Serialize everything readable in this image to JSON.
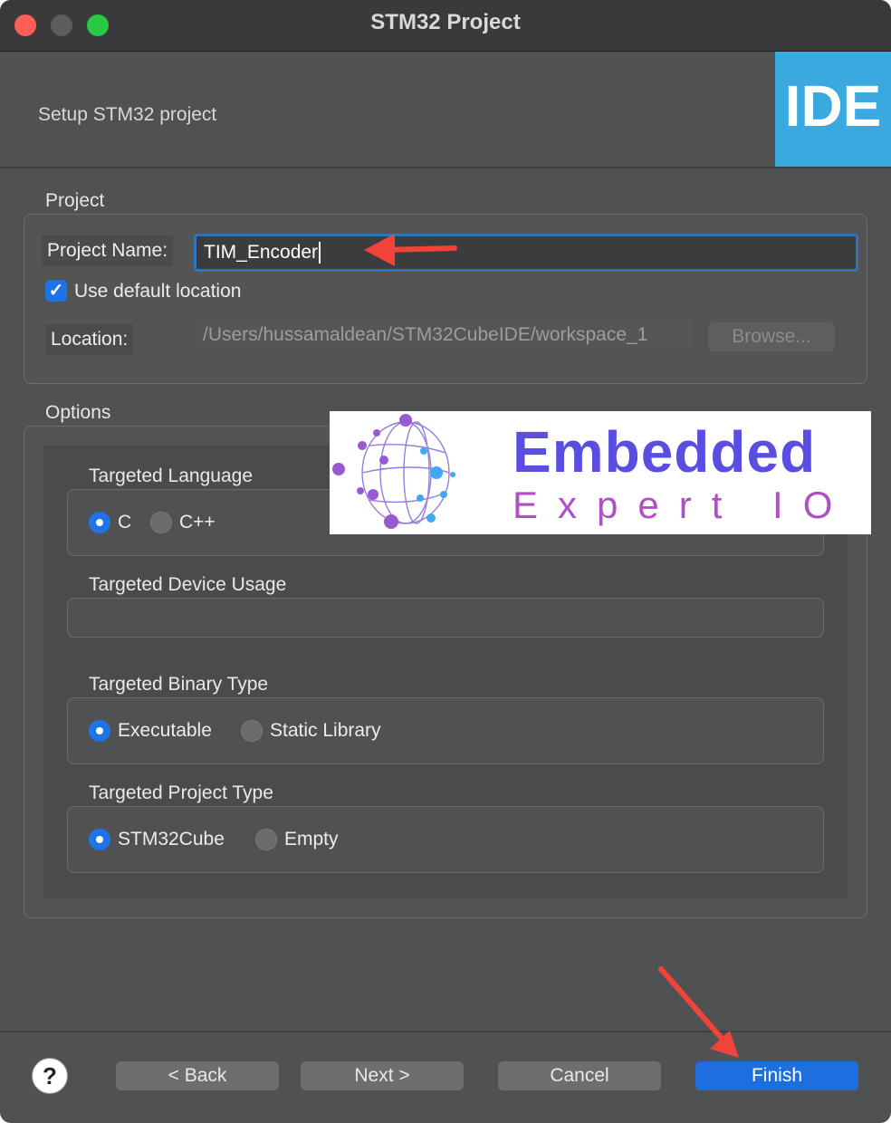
{
  "window": {
    "title": "STM32 Project"
  },
  "header": {
    "subtitle": "Setup STM32 project",
    "logo_text": "IDE"
  },
  "project": {
    "section_label": "Project",
    "name_label": "Project Name:",
    "name_value": "TIM_Encoder",
    "use_default_label": "Use default location",
    "use_default_checked": true,
    "location_label": "Location:",
    "location_value": "/Users/hussamaldean/STM32CubeIDE/workspace_1",
    "browse_label": "Browse..."
  },
  "options": {
    "section_label": "Options",
    "language": {
      "title": "Targeted Language",
      "options": [
        "C",
        "C++"
      ],
      "selected": "C"
    },
    "device_usage": {
      "title": "Targeted Device Usage"
    },
    "binary_type": {
      "title": "Targeted Binary Type",
      "options": [
        "Executable",
        "Static Library"
      ],
      "selected": "Executable"
    },
    "project_type": {
      "title": "Targeted Project Type",
      "options": [
        "STM32Cube",
        "Empty"
      ],
      "selected": "STM32Cube"
    }
  },
  "watermark": {
    "line1": "Embedded",
    "line2": "Expert IO"
  },
  "footer": {
    "help_icon": "?",
    "back_label": "< Back",
    "next_label": "Next >",
    "cancel_label": "Cancel",
    "finish_label": "Finish"
  },
  "annotations": {
    "arrow_color": "#f0443a"
  }
}
